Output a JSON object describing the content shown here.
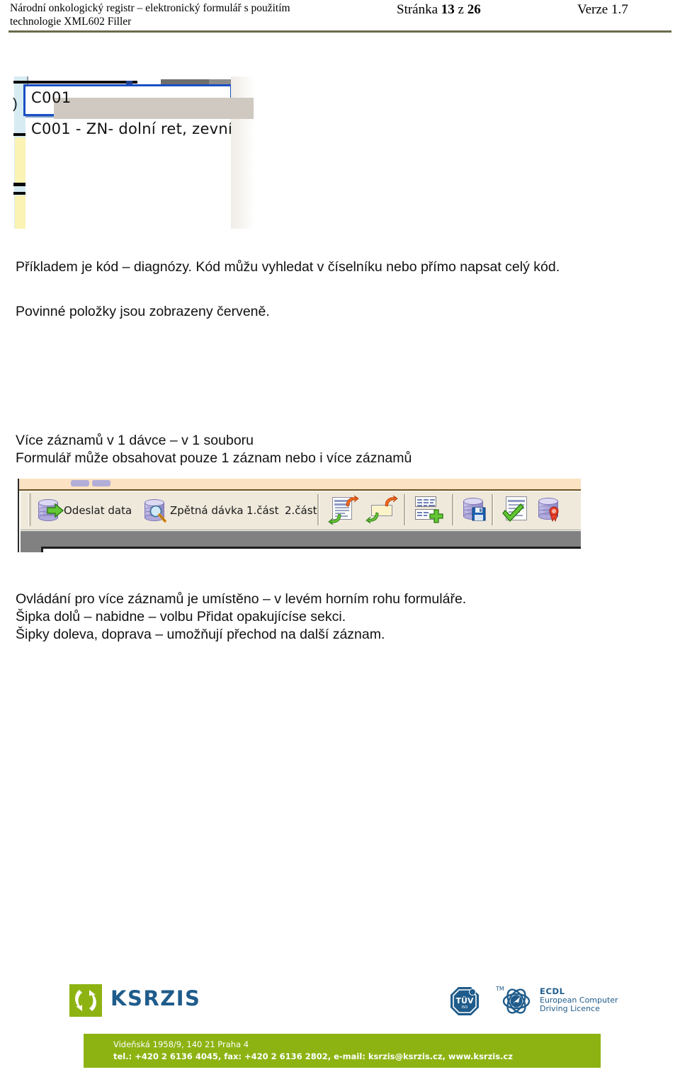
{
  "header": {
    "title_line1": "Národní onkologický registr – elektronický formulář s použitím",
    "title_line2": "technologie XML602 Filler",
    "page_prefix": "Stránka",
    "page_current": "13",
    "page_of": "z",
    "page_total": "26",
    "version": "Verze 1.7"
  },
  "combo_screenshot": {
    "paren_glyph": ")",
    "input_value": "C001",
    "list_item_1": "C001 - ZN- dolní ret, zevní",
    "focus_border_color": "#1a4fc4",
    "selection_color": "#cfc9c2",
    "required_field_color": "#fbf3b4"
  },
  "body": {
    "example_text": "Příkladem je kód – diagnózy. Kód můžu vyhledat v číselníku nebo přímo napsat celý kód.",
    "required_text": "Povinné položky jsou zobrazeny červeně.",
    "heading_line1": "Více záznamů v 1 dávce – v 1 souboru",
    "heading_line2": "Formulář může obsahovat pouze 1 záznam nebo i více záznamů",
    "footnote_line1": "Ovládání pro více záznamů je umístěno – v levém horním rohu formuláře.",
    "footnote_line2": "Šipka dolů – nabidne – volbu Přidat opakujícíse sekci.",
    "footnote_line3": "Šipky doleva, doprava – umožňují přechod na další záznam."
  },
  "toolbar_screenshot": {
    "send_data_label": "Odeslat data",
    "reverse_batch_label": "Zpětná dávka",
    "part1_label": "1.část",
    "part2_label": "2.část",
    "icons": {
      "send": "database-send-icon",
      "reverse": "database-search-icon",
      "prev_record": "document-prev-record-icon",
      "next_record": "field-next-record-icon",
      "add_section": "table-add-row-icon",
      "save": "database-save-icon",
      "validate": "document-check-icon",
      "sign": "database-seal-icon"
    },
    "toolbar_bg": "#efe9dc",
    "canvas_bg": "#818181"
  },
  "footer": {
    "logo_name": "KSRZIS",
    "ecdl_title": "ECDL",
    "ecdl_sub1": "European Computer",
    "ecdl_sub2": "Driving Licence",
    "ecdl_tm": "TM",
    "tuv_label": "TÜV",
    "address": "Videňská 1958/9, 140 21 Praha 4",
    "contact": "tel.: +420 2 6136 4045, fax: +420 2 6136 2802, e-mail: ksrzis@ksrzis.cz, www.ksrzis.cz",
    "brand_green": "#8db312",
    "brand_blue": "#1f5c8b"
  }
}
